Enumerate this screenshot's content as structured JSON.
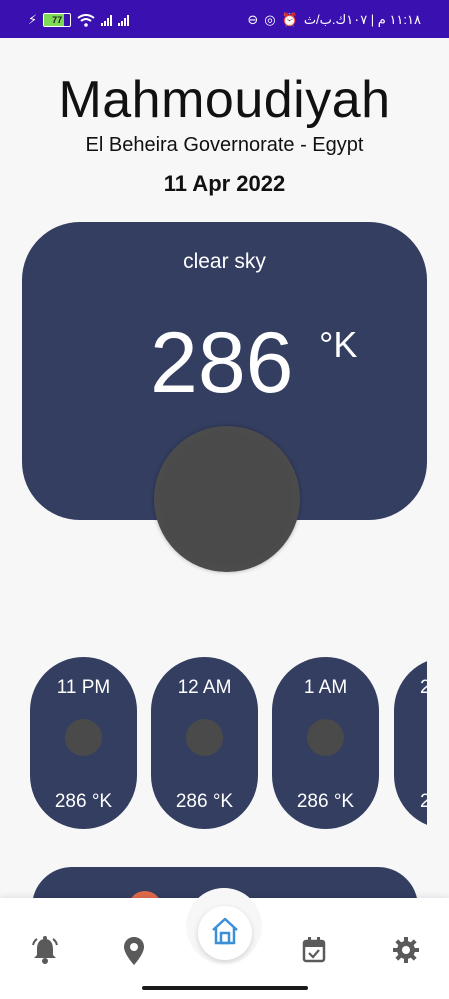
{
  "status_bar": {
    "battery_level": "77",
    "time_rtl": "١١:١٨ م | ١٠٧ك.ب/ث",
    "accent": "#3a10b0"
  },
  "location": {
    "city": "Mahmoudiyah",
    "region": "El Beheira Governorate - Egypt",
    "date": "11 Apr 2022"
  },
  "current": {
    "condition": "clear sky",
    "temperature": "286",
    "unit": "°K"
  },
  "hourly": [
    {
      "time": "11 PM",
      "temp": "286  °K"
    },
    {
      "time": "12 AM",
      "temp": "286  °K"
    },
    {
      "time": "1 AM",
      "temp": "286  °K"
    },
    {
      "time": "2",
      "temp": "2"
    }
  ],
  "nav": {
    "items": [
      "bell-icon",
      "location-pin-icon",
      "home-icon",
      "calendar-check-icon",
      "gear-icon"
    ],
    "active": "home-icon",
    "active_color": "#3a8fd6"
  },
  "colors": {
    "card": "#343e61",
    "background": "#f7f7f8"
  }
}
